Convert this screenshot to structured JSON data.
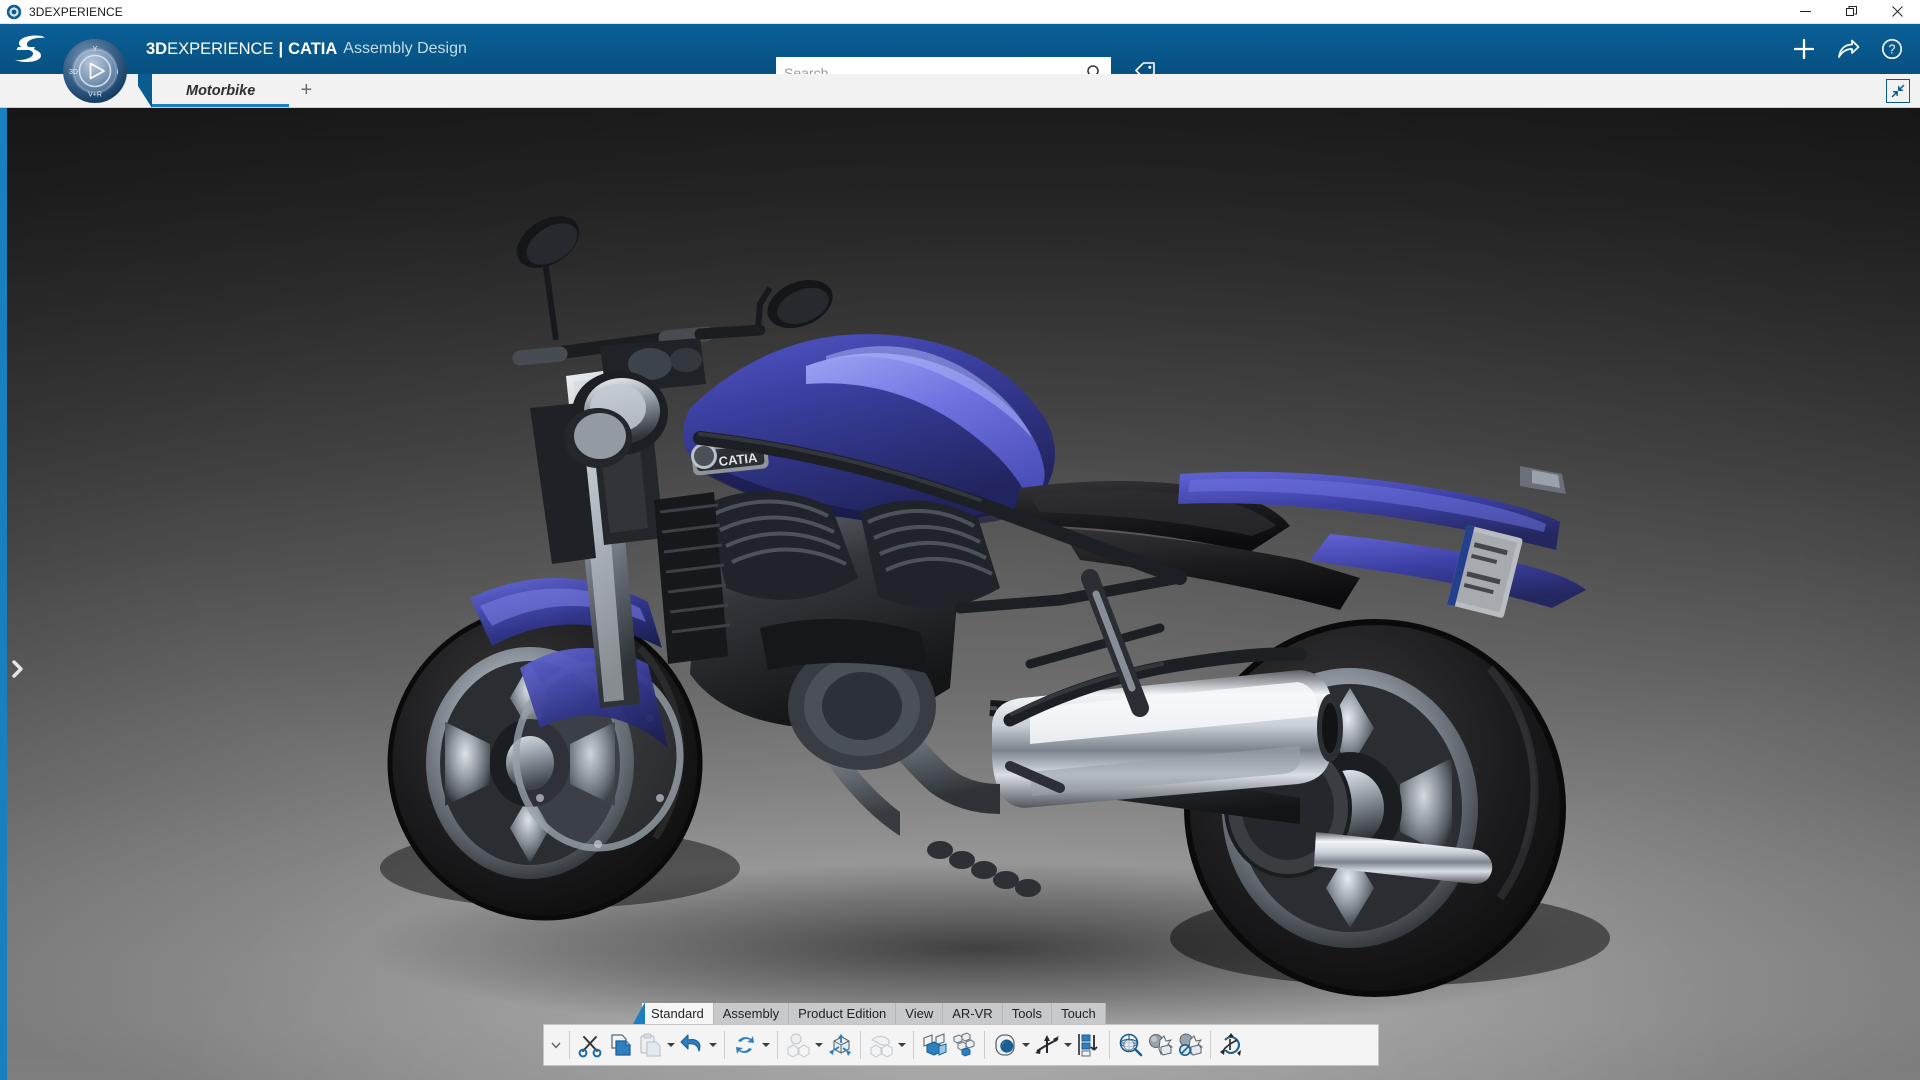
{
  "window": {
    "icon": "3dexperience-app-icon",
    "title": "3DEXPERIENCE",
    "controls": [
      {
        "name": "minimize-button",
        "glyph": "minimize"
      },
      {
        "name": "restore-button",
        "glyph": "restore"
      },
      {
        "name": "close-button",
        "glyph": "close"
      }
    ]
  },
  "header": {
    "brand_logo": "dassault-systemes-3ds-logo",
    "compass": {
      "name": "3dexperience-compass",
      "labels": {
        "west": "3D",
        "north": "Y",
        "east": "iᵖ",
        "south": "V+R"
      }
    },
    "title_bold": "3D",
    "title_rest": "EXPERIENCE",
    "separator": "|",
    "product": "CATIA",
    "module": "Assembly Design",
    "search": {
      "placeholder": "Search",
      "value": "",
      "icon": "search-icon"
    },
    "tag_icon": "tag-icon",
    "actions": [
      {
        "name": "add-button",
        "icon": "plus-icon"
      },
      {
        "name": "share-button",
        "icon": "share-arrow-icon"
      },
      {
        "name": "help-button",
        "icon": "help-question-icon"
      }
    ],
    "accent_color": "#0a5c90",
    "highlight_color": "#1a7fc1"
  },
  "tabs": {
    "documents": [
      {
        "label": "Motorbike",
        "active": true
      }
    ],
    "add_label": "+",
    "expand_icon": "collapse-diagonal-icon"
  },
  "viewport": {
    "model_name": "Motorbike",
    "badge_text": "CATIA",
    "body_color": "#3b3fa0",
    "body_highlight": "#6f72e0",
    "background_top": "#1f1f1f",
    "background_bottom": "#b4b4b4",
    "left_panel_handle": "chevron-right-icon"
  },
  "ribbon": {
    "tabs": [
      {
        "label": "Standard",
        "active": true
      },
      {
        "label": "Assembly",
        "active": false
      },
      {
        "label": "Product Edition",
        "active": false
      },
      {
        "label": "View",
        "active": false
      },
      {
        "label": "AR-VR",
        "active": false
      },
      {
        "label": "Tools",
        "active": false
      },
      {
        "label": "Touch",
        "active": false
      }
    ],
    "collapse_icon": "chevron-down-icon",
    "commands": [
      {
        "name": "cut-button",
        "icon": "scissors-icon",
        "caret": false,
        "enabled": true
      },
      {
        "name": "copy-button",
        "icon": "copy-pages-icon",
        "caret": false,
        "enabled": true
      },
      {
        "name": "paste-button",
        "icon": "clipboard-paste-icon",
        "caret": true,
        "enabled": false
      },
      {
        "name": "undo-button",
        "icon": "undo-arrow-icon",
        "caret": true,
        "enabled": true
      },
      {
        "name": "update-button",
        "icon": "update-refresh-icon",
        "caret": true,
        "enabled": true
      },
      {
        "name": "insert-component-button",
        "icon": "insert-component-icon",
        "caret": true,
        "enabled": false
      },
      {
        "name": "manipulate-button",
        "icon": "manipulation-axes-icon",
        "caret": false,
        "enabled": true
      },
      {
        "name": "snap-button",
        "icon": "snap-hand-icon",
        "caret": true,
        "enabled": false
      },
      {
        "name": "engineering-connection-button",
        "icon": "engineering-connection-icon",
        "caret": false,
        "enabled": true
      },
      {
        "name": "pattern-button",
        "icon": "reuse-pattern-icon",
        "caret": false,
        "enabled": true
      },
      {
        "name": "visualization-button",
        "icon": "visualization-sphere-icon",
        "caret": true,
        "enabled": true
      },
      {
        "name": "axis-system-button",
        "icon": "axis-system-icon",
        "caret": true,
        "enabled": true
      },
      {
        "name": "tree-reorder-button",
        "icon": "tree-reorder-icon",
        "caret": false,
        "enabled": true
      },
      {
        "name": "zoom-analysis-button",
        "icon": "magnifier-sections-icon",
        "caret": false,
        "enabled": true
      },
      {
        "name": "clash-button",
        "icon": "clash-detection-icon",
        "caret": false,
        "enabled": true
      },
      {
        "name": "clash-clear-button",
        "icon": "clash-clear-icon",
        "caret": false,
        "enabled": true
      },
      {
        "name": "measure-3d-button",
        "icon": "rotate-3d-measure-icon",
        "caret": false,
        "enabled": true
      }
    ]
  }
}
